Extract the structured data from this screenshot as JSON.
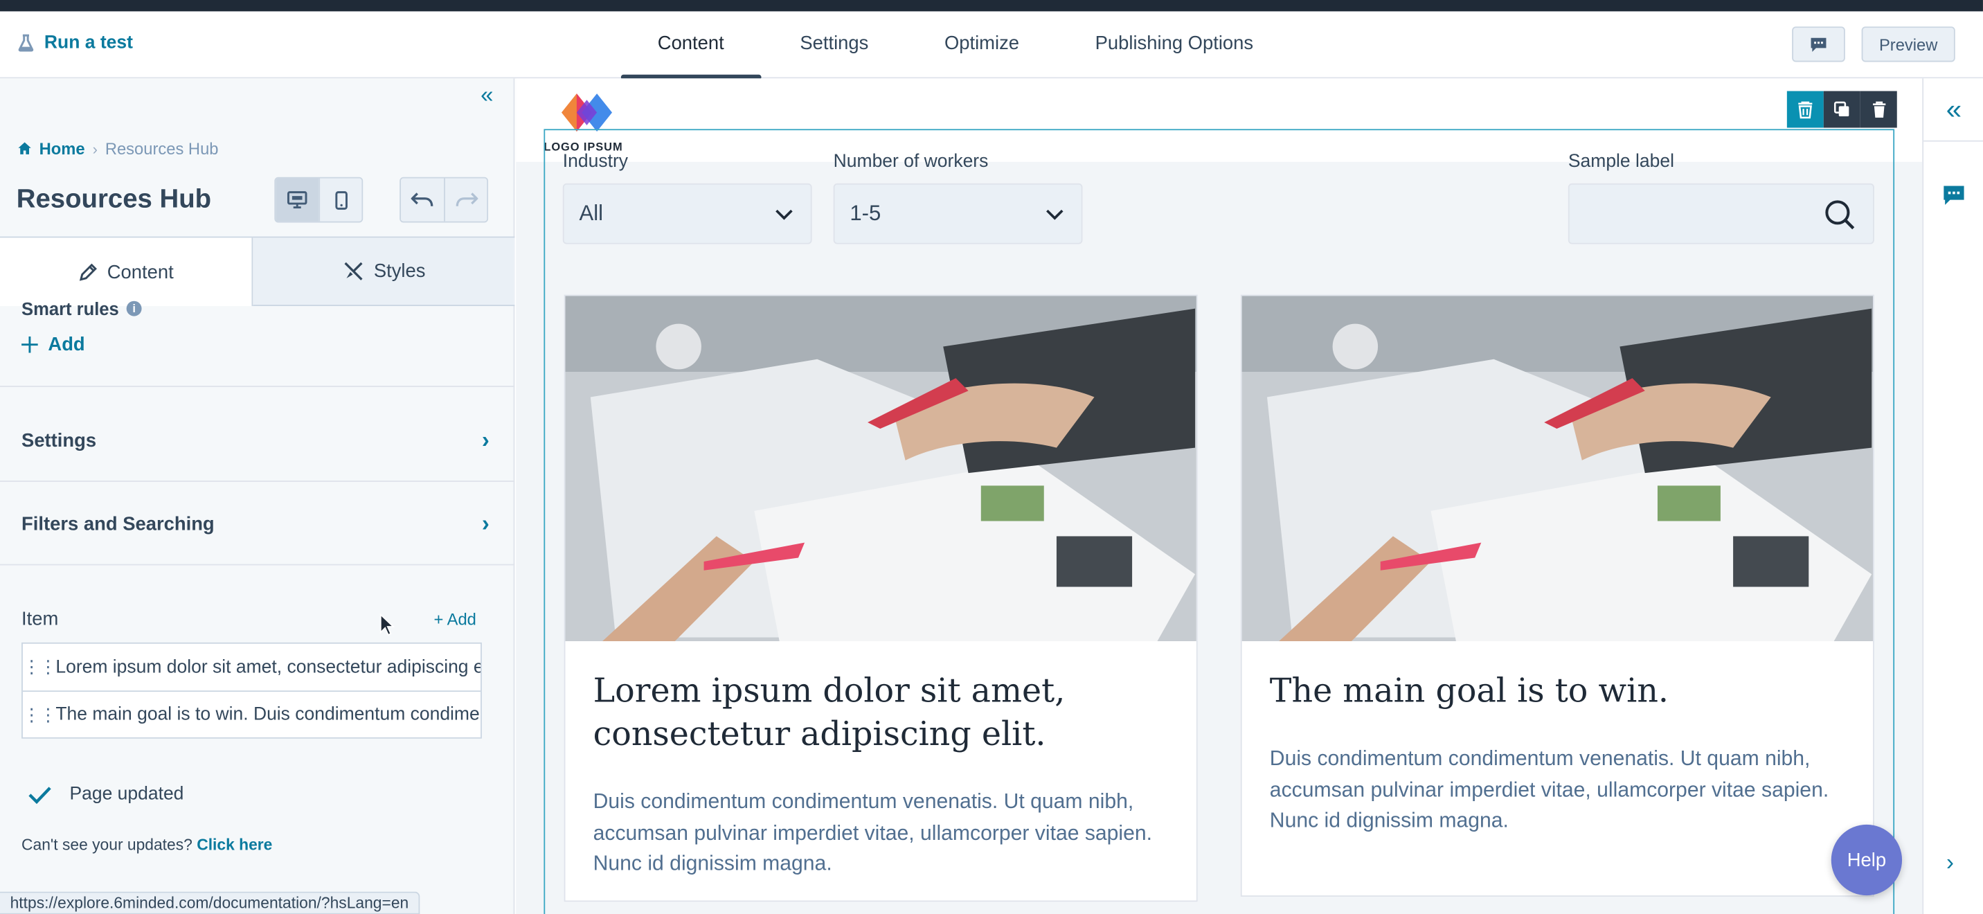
{
  "header": {
    "run_test": "Run a test",
    "tabs": [
      {
        "label": "Content"
      },
      {
        "label": "Settings"
      },
      {
        "label": "Optimize"
      },
      {
        "label": "Publishing Options"
      }
    ],
    "preview": "Preview"
  },
  "sidebar": {
    "breadcrumb": {
      "home": "Home",
      "current": "Resources Hub"
    },
    "title": "Resources Hub",
    "tabs": {
      "content": "Content",
      "styles": "Styles"
    },
    "smart_rules": "Smart rules",
    "add": "Add",
    "settings": "Settings",
    "filters_searching": "Filters and Searching",
    "item_label": "Item",
    "item_add": "+ Add",
    "items": [
      {
        "text": "Lorem ipsum dolor sit amet, consectetur adipiscing elit."
      },
      {
        "text": "The main goal is to win. Duis condimentum condimentum venenatis."
      }
    ],
    "page_updated": "Page updated",
    "cant_see": "Can't see your updates?",
    "click_here": "Click here",
    "status_url": "https://explore.6minded.com/documentation/?hsLang=en"
  },
  "canvas": {
    "logo_text": "LOGO IPSUM",
    "filters": {
      "industry_label": "Industry",
      "industry_value": "All",
      "workers_label": "Number of workers",
      "workers_value": "1-5",
      "search_label": "Sample label"
    },
    "cards": [
      {
        "title": "Lorem ipsum dolor sit amet, consectetur adipiscing elit.",
        "text": "Duis condimentum condimentum venenatis. Ut quam nibh, accumsan pulvinar imperdiet vitae, ullamcorper vitae sapien. Nunc id dignissim magna."
      },
      {
        "title": "The main goal is to win.",
        "text": "Duis condimentum condimentum venenatis. Ut quam nibh, accumsan pulvinar imperdiet vitae, ullamcorper vitae sapien. Nunc id dignissim magna."
      }
    ]
  },
  "help": "Help",
  "colors": {
    "accent": "#0b7a9e",
    "module_border": "#3ba7c4",
    "help": "#6a78d1"
  }
}
